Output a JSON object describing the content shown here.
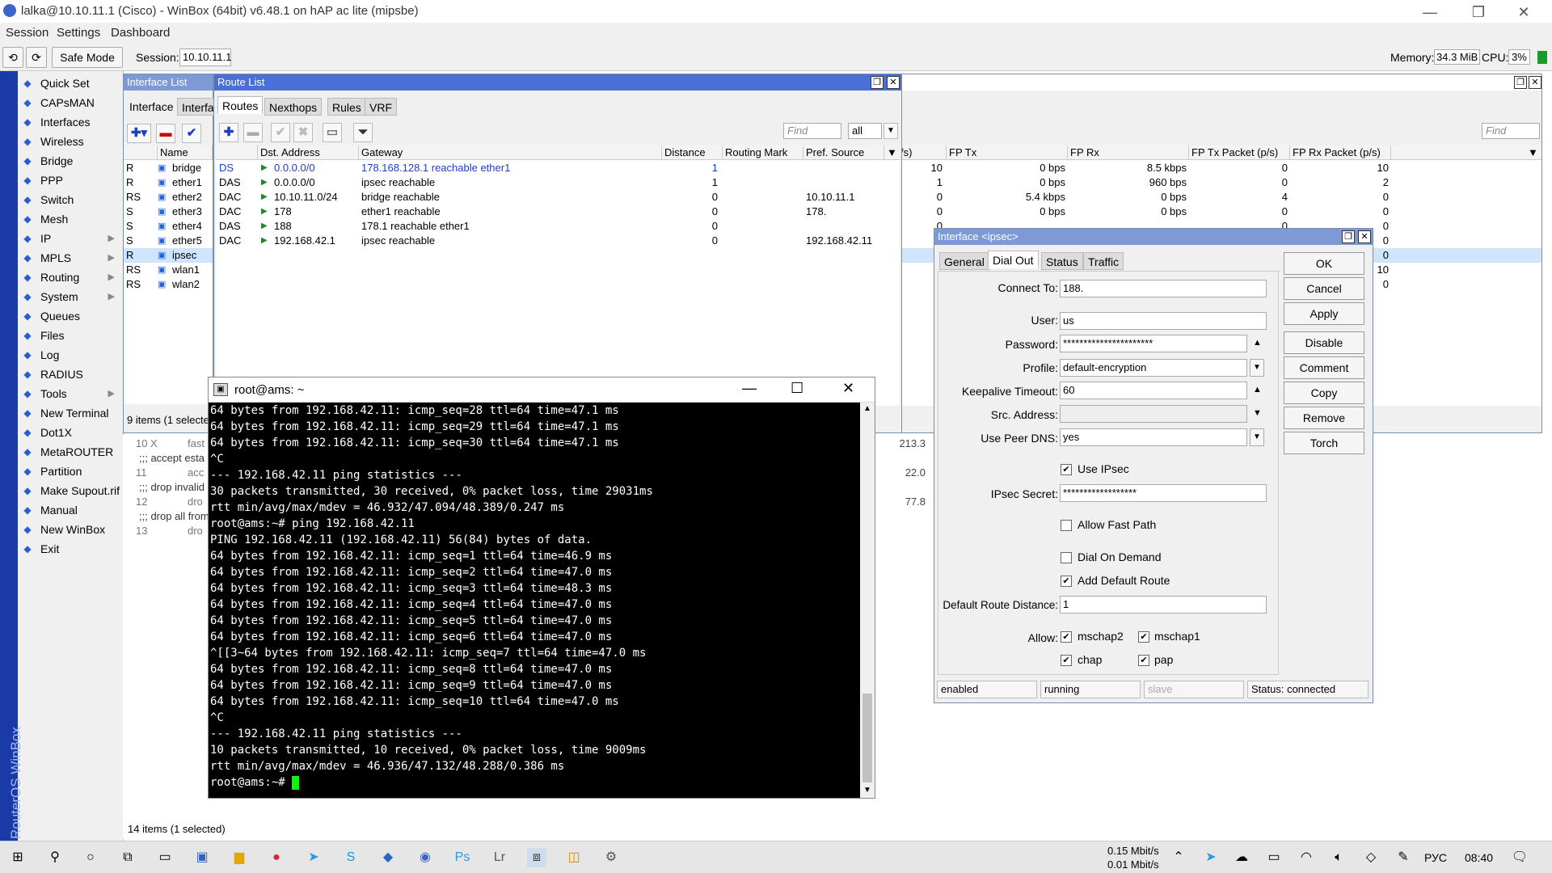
{
  "window": {
    "title": "lalka@10.10.11.1 (Cisco) - WinBox (64bit) v6.48.1 on hAP ac lite (mipsbe)"
  },
  "menu": [
    "Session",
    "Settings",
    "Dashboard"
  ],
  "toolbar": {
    "safe_mode": "Safe Mode",
    "session_label": "Session:",
    "session_value": "10.10.11.1",
    "memory_label": "Memory:",
    "memory_value": "34.3 MiB",
    "cpu_label": "CPU:",
    "cpu_value": "3%"
  },
  "sidebar": {
    "brand": "RouterOS WinBox",
    "items": [
      {
        "label": "Quick Set",
        "icon": "wand-icon",
        "sub": false
      },
      {
        "label": "CAPsMAN",
        "icon": "capsman-icon",
        "sub": false
      },
      {
        "label": "Interfaces",
        "icon": "interfaces-icon",
        "sub": false
      },
      {
        "label": "Wireless",
        "icon": "wireless-icon",
        "sub": false
      },
      {
        "label": "Bridge",
        "icon": "bridge-icon",
        "sub": false
      },
      {
        "label": "PPP",
        "icon": "ppp-icon",
        "sub": false
      },
      {
        "label": "Switch",
        "icon": "switch-icon",
        "sub": false
      },
      {
        "label": "Mesh",
        "icon": "mesh-icon",
        "sub": false
      },
      {
        "label": "IP",
        "icon": "ip-icon",
        "sub": true
      },
      {
        "label": "MPLS",
        "icon": "mpls-icon",
        "sub": true
      },
      {
        "label": "Routing",
        "icon": "routing-icon",
        "sub": true
      },
      {
        "label": "System",
        "icon": "system-icon",
        "sub": true
      },
      {
        "label": "Queues",
        "icon": "queues-icon",
        "sub": false
      },
      {
        "label": "Files",
        "icon": "files-icon",
        "sub": false
      },
      {
        "label": "Log",
        "icon": "log-icon",
        "sub": false
      },
      {
        "label": "RADIUS",
        "icon": "radius-icon",
        "sub": false
      },
      {
        "label": "Tools",
        "icon": "tools-icon",
        "sub": true
      },
      {
        "label": "New Terminal",
        "icon": "terminal-icon",
        "sub": false
      },
      {
        "label": "Dot1X",
        "icon": "dot1x-icon",
        "sub": false
      },
      {
        "label": "MetaROUTER",
        "icon": "metarouter-icon",
        "sub": false
      },
      {
        "label": "Partition",
        "icon": "partition-icon",
        "sub": false
      },
      {
        "label": "Make Supout.rif",
        "icon": "supout-icon",
        "sub": false
      },
      {
        "label": "Manual",
        "icon": "manual-icon",
        "sub": false
      },
      {
        "label": "New WinBox",
        "icon": "winbox-icon",
        "sub": false
      },
      {
        "label": "Exit",
        "icon": "exit-icon",
        "sub": false
      }
    ]
  },
  "interface_list": {
    "title": "Interface List",
    "tabs": [
      "Interface",
      "Interfac"
    ],
    "col_name": "Name",
    "rows": [
      {
        "flags": "R",
        "name": "bridge",
        "sel": false
      },
      {
        "flags": "R",
        "name": "ether1",
        "sel": false
      },
      {
        "flags": "RS",
        "name": "ether2",
        "sel": false
      },
      {
        "flags": "S",
        "name": "ether3",
        "sel": false
      },
      {
        "flags": "S",
        "name": "ether4",
        "sel": false
      },
      {
        "flags": "S",
        "name": "ether5",
        "sel": false
      },
      {
        "flags": "R",
        "name": "ipsec",
        "sel": true
      },
      {
        "flags": "RS",
        "name": "wlan1",
        "sel": false
      },
      {
        "flags": "RS",
        "name": "wlan2",
        "sel": false
      }
    ],
    "status": "9 items (1 selecte"
  },
  "route_list": {
    "title": "Route List",
    "tabs": [
      "Routes",
      "Nexthops",
      "Rules",
      "VRF"
    ],
    "find_placeholder": "Find",
    "filter_value": "all",
    "columns": [
      "Dst. Address",
      "Gateway",
      "Distance",
      "Routing Mark",
      "Pref. Source"
    ],
    "rows": [
      {
        "flags": "DS",
        "dst": "0.0.0.0/0",
        "gw": "178.168.128.1 reachable ether1",
        "dist": "1",
        "mark": "",
        "pref": "",
        "blue": true
      },
      {
        "flags": "DAS",
        "dst": "0.0.0.0/0",
        "gw": "ipsec reachable",
        "dist": "1",
        "mark": "",
        "pref": "",
        "blue": false
      },
      {
        "flags": "DAC",
        "dst": "10.10.11.0/24",
        "gw": "bridge reachable",
        "dist": "0",
        "mark": "",
        "pref": "10.10.11.1",
        "blue": false
      },
      {
        "flags": "DAC",
        "dst": "178",
        "gw": "ether1 reachable",
        "dist": "0",
        "mark": "",
        "pref": "178.",
        "blue": false
      },
      {
        "flags": "DAS",
        "dst": "188",
        "gw": "178.1               reachable ether1",
        "dist": "0",
        "mark": "",
        "pref": "",
        "blue": false
      },
      {
        "flags": "DAC",
        "dst": "192.168.42.1",
        "gw": "ipsec reachable",
        "dist": "0",
        "mark": "",
        "pref": "192.168.42.11",
        "blue": false
      }
    ]
  },
  "traffic_panel": {
    "find_placeholder": "Find",
    "columns": [
      "FP Tx",
      "FP Rx",
      "FP Tx Packet (p/s)",
      "FP Rx Packet (p/s)"
    ],
    "rows": [
      {
        "p": "10",
        "fptx": "0 bps",
        "fprx": "8.5 kbps",
        "txp": "0",
        "rxp": "10"
      },
      {
        "p": "1",
        "fptx": "0 bps",
        "fprx": "960 bps",
        "txp": "0",
        "rxp": "2"
      },
      {
        "p": "0",
        "fptx": "5.4 kbps",
        "fprx": "0 bps",
        "txp": "4",
        "rxp": "0"
      },
      {
        "p": "0",
        "fptx": "0 bps",
        "fprx": "0 bps",
        "txp": "0",
        "rxp": "0"
      },
      {
        "p": "0",
        "fptx": "",
        "fprx": "",
        "txp": "0",
        "rxp": "0"
      },
      {
        "p": "0",
        "fptx": "",
        "fprx": "",
        "txp": "",
        "rxp": "0"
      },
      {
        "p": "0",
        "fptx": "",
        "fprx": "",
        "txp": "",
        "rxp": "0"
      },
      {
        "p": "0",
        "fptx": "",
        "fprx": "",
        "txp": "",
        "rxp": "10"
      },
      {
        "p": "0",
        "fptx": "",
        "fprx": "",
        "txp": "",
        "rxp": "0"
      }
    ]
  },
  "firewall_peek": {
    "rows": [
      {
        "n": "10",
        "x": "X",
        "t": "fast",
        "v": "213.3"
      },
      {
        "n": "",
        "x": "",
        "t": ";;; accept esta",
        "v": ""
      },
      {
        "n": "11",
        "x": "",
        "t": "acc",
        "v": "22.0"
      },
      {
        "n": "",
        "x": "",
        "t": ";;; drop invalid",
        "v": ""
      },
      {
        "n": "12",
        "x": "",
        "t": "dro",
        "v": "77.8"
      },
      {
        "n": "",
        "x": "",
        "t": ";;; drop all from",
        "v": ""
      },
      {
        "n": "13",
        "x": "",
        "t": "dro",
        "v": ""
      }
    ],
    "status": "14 items (1 selected)"
  },
  "terminal": {
    "title": "root@ams: ~",
    "lines": [
      "64 bytes from 192.168.42.11: icmp_seq=28 ttl=64 time=47.1 ms",
      "64 bytes from 192.168.42.11: icmp_seq=29 ttl=64 time=47.1 ms",
      "64 bytes from 192.168.42.11: icmp_seq=30 ttl=64 time=47.1 ms",
      "^C",
      "--- 192.168.42.11 ping statistics ---",
      "30 packets transmitted, 30 received, 0% packet loss, time 29031ms",
      "rtt min/avg/max/mdev = 46.932/47.094/48.389/0.247 ms",
      "root@ams:~# ping 192.168.42.11",
      "PING 192.168.42.11 (192.168.42.11) 56(84) bytes of data.",
      "64 bytes from 192.168.42.11: icmp_seq=1 ttl=64 time=46.9 ms",
      "64 bytes from 192.168.42.11: icmp_seq=2 ttl=64 time=47.0 ms",
      "64 bytes from 192.168.42.11: icmp_seq=3 ttl=64 time=48.3 ms",
      "64 bytes from 192.168.42.11: icmp_seq=4 ttl=64 time=47.0 ms",
      "64 bytes from 192.168.42.11: icmp_seq=5 ttl=64 time=47.0 ms",
      "64 bytes from 192.168.42.11: icmp_seq=6 ttl=64 time=47.0 ms",
      "^[[3~64 bytes from 192.168.42.11: icmp_seq=7 ttl=64 time=47.0 ms",
      "64 bytes from 192.168.42.11: icmp_seq=8 ttl=64 time=47.0 ms",
      "64 bytes from 192.168.42.11: icmp_seq=9 ttl=64 time=47.0 ms",
      "64 bytes from 192.168.42.11: icmp_seq=10 ttl=64 time=47.0 ms",
      "^C",
      "--- 192.168.42.11 ping statistics ---",
      "10 packets transmitted, 10 received, 0% packet loss, time 9009ms",
      "rtt min/avg/max/mdev = 46.936/47.132/48.288/0.386 ms"
    ],
    "prompt": "root@ams:~# "
  },
  "dialog": {
    "title": "Interface <ipsec>",
    "tabs": [
      "General",
      "Dial Out",
      "Status",
      "Traffic"
    ],
    "connect_to_label": "Connect To:",
    "connect_to": "188.",
    "user_label": "User:",
    "user": "us",
    "password_label": "Password:",
    "password": "**********************",
    "profile_label": "Profile:",
    "profile": "default-encryption",
    "keepalive_label": "Keepalive Timeout:",
    "keepalive": "60",
    "src_label": "Src. Address:",
    "src": "",
    "dns_label": "Use Peer DNS:",
    "dns": "yes",
    "use_ipsec": "Use IPsec",
    "secret_label": "IPsec Secret:",
    "secret": "******************",
    "fast_path": "Allow Fast Path",
    "dial_on_demand": "Dial On Demand",
    "add_default": "Add Default Route",
    "route_dist_label": "Default Route Distance:",
    "route_dist": "1",
    "allow_label": "Allow:",
    "allow": [
      "mschap2",
      "mschap1",
      "chap",
      "pap"
    ],
    "buttons": [
      "OK",
      "Cancel",
      "Apply",
      "Disable",
      "Comment",
      "Copy",
      "Remove",
      "Torch"
    ],
    "status": [
      "enabled",
      "running",
      "slave",
      "Status: connected"
    ]
  },
  "taskbar": {
    "net_up": "0.15 Mbit/s",
    "net_down": "0.01 Mbit/s",
    "lang": "РУС",
    "time": "08:40"
  }
}
